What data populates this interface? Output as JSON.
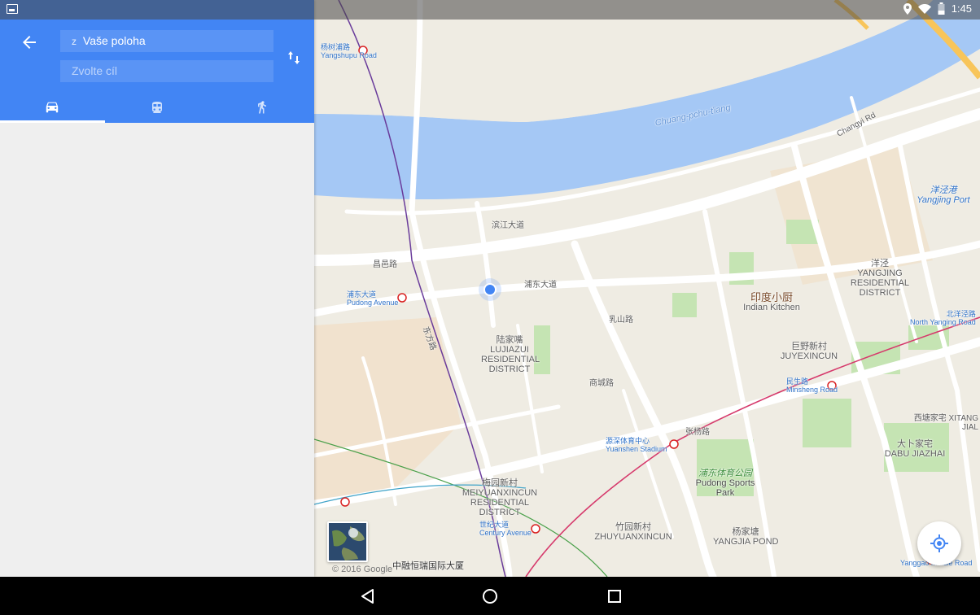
{
  "status_bar": {
    "time": "1:45"
  },
  "directions": {
    "origin": {
      "prefix": "z",
      "value": "Vaše poloha"
    },
    "destination": {
      "placeholder": "Zvolte cíl"
    },
    "tabs": [
      {
        "name": "driving",
        "icon": "car-icon",
        "selected": true
      },
      {
        "name": "transit",
        "icon": "train-icon",
        "selected": false
      },
      {
        "name": "walking",
        "icon": "walk-icon",
        "selected": false
      }
    ]
  },
  "map": {
    "copyright": "© 2016 Google",
    "labels": {
      "river": "Chuang-pchu-ťiang",
      "lujiazui_cn": "陆家嘴",
      "lujiazui": "LUJIAZUI RESIDENTIAL DISTRICT",
      "yangjing_cn": "洋泾",
      "yangjing": "YANGJING RESIDENTIAL DISTRICT",
      "indian_kitchen_cn": "印度小厨",
      "indian_kitchen": "Indian Kitchen",
      "juyexincun_cn": "巨野新村",
      "juyexincun": "JUYEXINCUN",
      "meiyuan_cn": "梅园新村",
      "meiyuan": "MEIYUANXINCUN RESIDENTIAL DISTRICT",
      "zhuyuan_cn": "竹园新村",
      "zhuyuan": "ZHUYUANXINCUN",
      "pudong_park_cn": "浦东体育公园",
      "pudong_park": "Pudong Sports Park",
      "yangjia_cn": "杨家塘",
      "yangjia": "YANGJIA POND",
      "dabu_cn": "大卜家宅",
      "dabu": "DABU JIAZHAI",
      "xitang": "西塘家宅 XITANG JIAL",
      "yangjing_port_cn": "洋泾港",
      "yangjing_port": "Yangjing Port",
      "pudong_avenue_cn": "浦东大道",
      "pudong_avenue": "Pudong Avenue",
      "minsheng_cn": "民生路",
      "minsheng": "Minsheng Road",
      "yuanshen_cn": "源深体育中心",
      "yuanshen": "Yuanshen Stadium",
      "century_cn": "世纪大道",
      "century": "Century Avenue",
      "north_yanggao_cn": "北洋泾路",
      "north_yanggao": "North Yanging Road",
      "yanggao_middle_cn": "杨高中路",
      "yanggao_middle": "Yanggao Middle Road",
      "yangshupu_cn": "杨树浦路",
      "yangshupu": "Yangshupu Road",
      "binjiang": "滨江大道",
      "changyi": "昌邑路",
      "pudong_dadao": "浦东大道",
      "rushan": "乳山路",
      "zhangyang": "张杨路",
      "dongfang": "东方路",
      "shangcheng": "商城路",
      "building": "中融恒瑞国际大厦",
      "changyi_rd": "Changyi Rd"
    }
  }
}
